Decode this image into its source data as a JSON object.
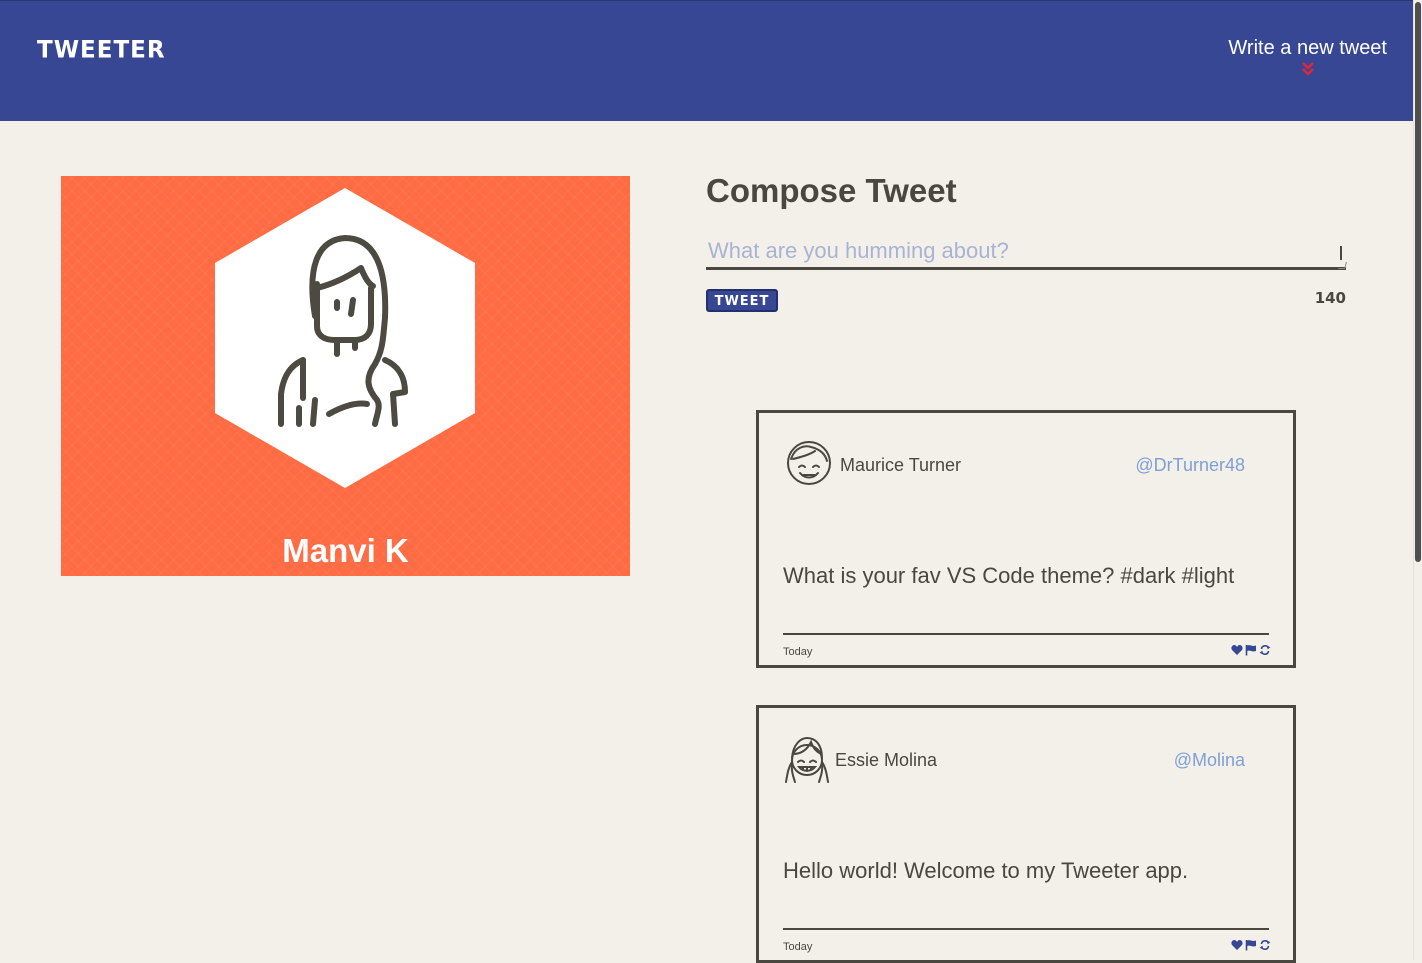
{
  "nav": {
    "brand": "TWEETER",
    "write_link": "Write a new tweet",
    "chevron_icon": "double-chevron-down-icon",
    "accent": "#e0263a"
  },
  "profile": {
    "name": "Manvi K",
    "avatar_icon": "woman-avatar-icon",
    "background_color": "#ff6b42"
  },
  "compose": {
    "title": "Compose Tweet",
    "placeholder": "What are you humming about?",
    "value": "",
    "button_label": "TWEET",
    "counter": "140"
  },
  "tweets": [
    {
      "name": "Maurice Turner",
      "handle": "@DrTurner48",
      "text": "What is your fav VS Code theme? #dark #light",
      "date": "Today",
      "avatar_icon": "smiling-man-avatar-icon"
    },
    {
      "name": "Essie Molina",
      "handle": "@Molina",
      "text": "Hello world! Welcome to my Tweeter app.",
      "date": "Today",
      "avatar_icon": "pigtails-girl-avatar-icon"
    }
  ],
  "colors": {
    "nav_bg": "#374793",
    "page_bg": "#f3f0ea",
    "text": "#4a4741",
    "handle": "#7f9fd6",
    "placeholder": "#a9b3d3"
  }
}
